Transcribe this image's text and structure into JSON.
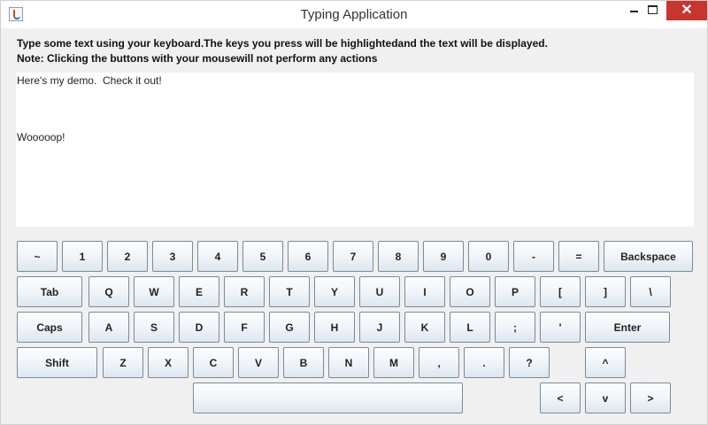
{
  "window": {
    "title": "Typing Application",
    "controls": {
      "minimize": "",
      "maximize": "",
      "close": "✕"
    }
  },
  "instructions": {
    "line1": "Type some text using your keyboard.The keys you press will be highlightedand the text will be displayed.",
    "line2": "Note: Clicking the buttons with your mousewill not perform any actions"
  },
  "text_area": {
    "lines": [
      "Here's my demo.  Check it out!",
      "Wooooop!"
    ]
  },
  "keyboard": {
    "rows": [
      [
        "~",
        "1",
        "2",
        "3",
        "4",
        "5",
        "6",
        "7",
        "8",
        "9",
        "0",
        "-",
        "=",
        "Backspace"
      ],
      [
        "Tab",
        "Q",
        "W",
        "E",
        "R",
        "T",
        "Y",
        "U",
        "I",
        "O",
        "P",
        "[",
        "]",
        "\\"
      ],
      [
        "Caps",
        "A",
        "S",
        "D",
        "F",
        "G",
        "H",
        "J",
        "K",
        "L",
        ";",
        "'",
        "Enter"
      ],
      [
        "Shift",
        "Z",
        "X",
        "C",
        "V",
        "B",
        "N",
        "M",
        ",",
        ".",
        "?",
        "^"
      ],
      [
        "",
        "<",
        "v",
        ">"
      ]
    ]
  }
}
